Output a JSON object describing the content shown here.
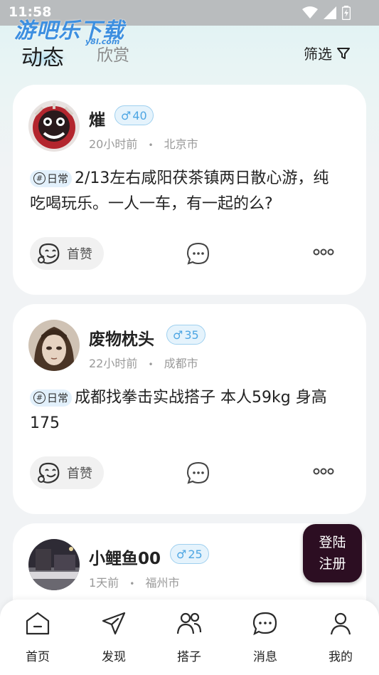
{
  "status_bar": {
    "time": "11:58"
  },
  "watermark": {
    "text": "游吧乐下载",
    "sub": "y8l.com"
  },
  "header": {
    "tabs": [
      {
        "label": "动态"
      },
      {
        "label": "欣赏"
      }
    ],
    "filter_label": "筛选"
  },
  "posts": [
    {
      "username": "熣",
      "gender_icon": "male-symbol",
      "gender_symbol": "♂",
      "age": "40",
      "time": "20小时前",
      "separator": "•",
      "location": "北京市",
      "tag_symbol": "#",
      "tag": "日常",
      "text": "2/13左右咸阳茯茶镇两日散心游，纯吃喝玩乐。一人一车，有一起的么?",
      "like_label": "首赞"
    },
    {
      "username": "废物枕头",
      "gender_icon": "male-symbol",
      "gender_symbol": "♂",
      "age": "35",
      "time": "22小时前",
      "separator": "•",
      "location": "成都市",
      "tag_symbol": "#",
      "tag": "日常",
      "text": "成都找拳击实战搭子 本人59kg 身高175",
      "like_label": "首赞"
    },
    {
      "username": "小鲤鱼00",
      "gender_icon": "male-symbol",
      "gender_symbol": "♂",
      "age": "25",
      "time": "1天前",
      "separator": "•",
      "location": "福州市"
    }
  ],
  "login_button": {
    "line1": "登陆",
    "line2": "注册"
  },
  "bottom_nav": [
    {
      "label": "首页",
      "icon": "home-icon"
    },
    {
      "label": "发现",
      "icon": "paper-plane-icon"
    },
    {
      "label": "搭子",
      "icon": "people-icon"
    },
    {
      "label": "消息",
      "icon": "chat-bubble-icon"
    },
    {
      "label": "我的",
      "icon": "person-icon"
    }
  ],
  "colors": {
    "accent_dark": "#2c0e22",
    "gender_badge": "#4ea6e3",
    "tag_bg": "#e2f0fb"
  }
}
